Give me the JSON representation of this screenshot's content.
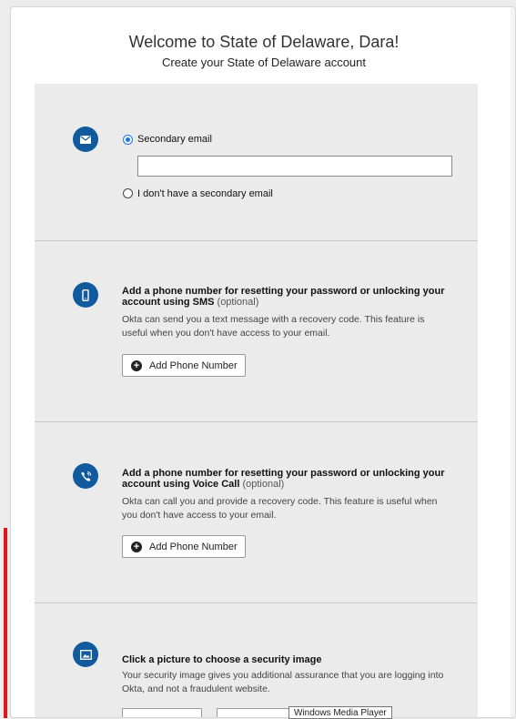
{
  "header": {
    "welcome": "Welcome to State of Delaware, Dara!",
    "subtitle": "Create your State of Delaware account"
  },
  "email_section": {
    "icon": "envelope-icon",
    "option_primary": "Secondary email",
    "email_value": "",
    "option_none": "I don't have a secondary email"
  },
  "sms_section": {
    "icon": "mobile-phone-icon",
    "title_main": "Add a phone number for resetting your password or unlocking your account using SMS",
    "title_optional": "(optional)",
    "description": "Okta can send you a text message with a recovery code. This feature is useful when you don't have access to your email.",
    "button_label": "Add Phone Number"
  },
  "voice_section": {
    "icon": "voice-call-icon",
    "title_main": "Add a phone number for resetting your password or unlocking your account using Voice Call",
    "title_optional": "(optional)",
    "description": "Okta can call you and provide a recovery code. This feature is useful when you don't have access to your email.",
    "button_label": "Add Phone Number"
  },
  "image_section": {
    "icon": "picture-icon",
    "title": "Click a picture to choose a security image",
    "description": "Your security image gives you additional assurance that you are logging into Okta, and not a fraudulent website."
  },
  "tooltip": {
    "text": "Windows Media Player"
  },
  "colors": {
    "accent": "#115a9e",
    "radio": "#1a73e8",
    "section_bg": "#ebebeb"
  }
}
